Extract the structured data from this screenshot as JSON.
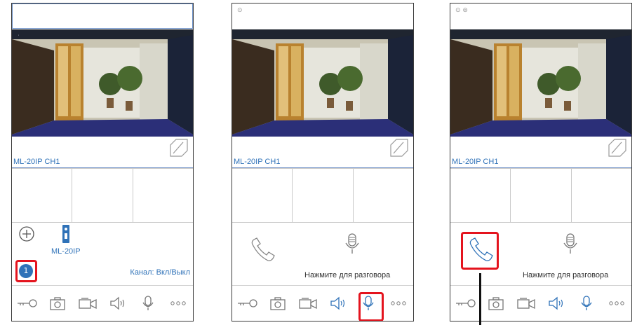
{
  "panels": [
    {
      "status_icons": "",
      "camera_caption": "ML-20IP CH1",
      "device_label": "ML-20IP",
      "badge_number": "1",
      "channel_label": "Канал: Вкл/Выкл",
      "active_tool": "none"
    },
    {
      "status_icons": "⊙",
      "camera_caption": "ML-20IP CH1",
      "talk_label": "Нажмите для разговора",
      "active_tool": "mic"
    },
    {
      "status_icons": "⊙ ⊚",
      "camera_caption": "ML-20IP CH1",
      "talk_label": "Нажмите для разговора",
      "active_tool": "mic"
    }
  ],
  "toolbar_icons": [
    "key-icon",
    "camera-icon",
    "video-record-icon",
    "speaker-icon",
    "microphone-icon",
    "more-icon"
  ],
  "colors": {
    "accent": "#2f72b8",
    "highlight": "#e4141e",
    "border": "#3a3a3a"
  }
}
